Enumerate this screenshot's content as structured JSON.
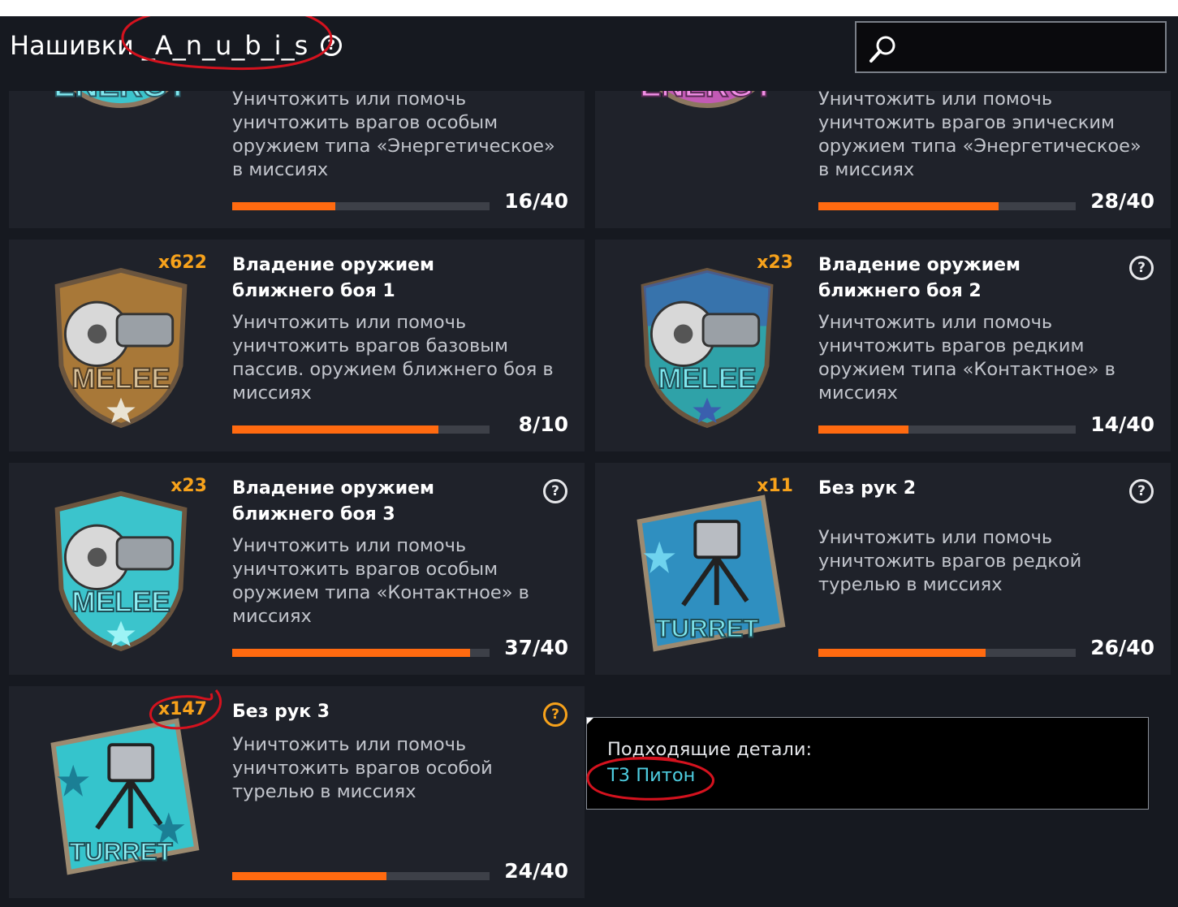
{
  "header": {
    "title": "Нашивки _A_n_u_b_i_s",
    "help_glyph": "?"
  },
  "colors": {
    "background": "#161920",
    "card": "#1f222a",
    "accent_orange": "#ff6a10",
    "count_yellow": "#f7a21b",
    "link_cyan": "#4ecde0",
    "annotation_red": "#d4121e"
  },
  "cards": [
    {
      "title": "",
      "desc": "Уничтожить или помочь уничтожить врагов особым оружием типа «Энергетическое» в миссиях",
      "count": "",
      "progress": "16/40",
      "progress_fraction": 0.4,
      "badge": "energy-badge-teal",
      "help": false
    },
    {
      "title": "",
      "desc": "Уничтожить или помочь уничтожить врагов эпическим оружием типа «Энергетическое» в миссиях",
      "count": "",
      "progress": "28/40",
      "progress_fraction": 0.7,
      "badge": "energy-badge-pink",
      "help": false
    },
    {
      "title": "Владение оружием ближнего боя 1",
      "desc": "Уничтожить или помочь уничтожить врагов базовым пассив. оружием ближнего боя в миссиях",
      "count": "x622",
      "progress": "8/10",
      "progress_fraction": 0.8,
      "badge": "melee-badge-bronze",
      "help": false
    },
    {
      "title": "Владение оружием ближнего боя 2",
      "desc": "Уничтожить или помочь уничтожить врагов редким оружием типа «Контактное» в миссиях",
      "count": "x23",
      "progress": "14/40",
      "progress_fraction": 0.35,
      "badge": "melee-badge-blue",
      "help": true
    },
    {
      "title": "Владение оружием ближнего боя 3",
      "desc": "Уничтожить или помочь уничтожить врагов особым оружием типа «Контактное» в миссиях",
      "count": "x23",
      "progress": "37/40",
      "progress_fraction": 0.925,
      "badge": "melee-badge-teal",
      "help": true
    },
    {
      "title": "Без рук 2",
      "desc": "Уничтожить или помочь уничтожить врагов редкой турелью в миссиях",
      "count": "x11",
      "progress": "26/40",
      "progress_fraction": 0.65,
      "badge": "turret-badge-blue",
      "help": true
    },
    {
      "title": "Без рук 3",
      "desc": "Уничтожить или помочь уничтожить врагов особой турелью в миссиях",
      "count": "x147",
      "progress": "24/40",
      "progress_fraction": 0.6,
      "badge": "turret-badge-teal",
      "help": true,
      "help_active": true
    }
  ],
  "tooltip": {
    "label": "Подходящие детали:",
    "link": "Т3 Питон"
  }
}
